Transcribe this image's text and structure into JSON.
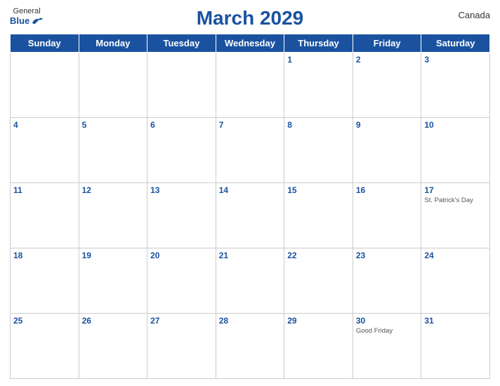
{
  "header": {
    "logo": {
      "general": "General",
      "blue": "Blue"
    },
    "title": "March 2029",
    "country": "Canada"
  },
  "weekdays": [
    "Sunday",
    "Monday",
    "Tuesday",
    "Wednesday",
    "Thursday",
    "Friday",
    "Saturday"
  ],
  "weeks": [
    [
      {
        "day": "",
        "event": ""
      },
      {
        "day": "",
        "event": ""
      },
      {
        "day": "",
        "event": ""
      },
      {
        "day": "",
        "event": ""
      },
      {
        "day": "1",
        "event": ""
      },
      {
        "day": "2",
        "event": ""
      },
      {
        "day": "3",
        "event": ""
      }
    ],
    [
      {
        "day": "4",
        "event": ""
      },
      {
        "day": "5",
        "event": ""
      },
      {
        "day": "6",
        "event": ""
      },
      {
        "day": "7",
        "event": ""
      },
      {
        "day": "8",
        "event": ""
      },
      {
        "day": "9",
        "event": ""
      },
      {
        "day": "10",
        "event": ""
      }
    ],
    [
      {
        "day": "11",
        "event": ""
      },
      {
        "day": "12",
        "event": ""
      },
      {
        "day": "13",
        "event": ""
      },
      {
        "day": "14",
        "event": ""
      },
      {
        "day": "15",
        "event": ""
      },
      {
        "day": "16",
        "event": ""
      },
      {
        "day": "17",
        "event": "St. Patrick's Day"
      }
    ],
    [
      {
        "day": "18",
        "event": ""
      },
      {
        "day": "19",
        "event": ""
      },
      {
        "day": "20",
        "event": ""
      },
      {
        "day": "21",
        "event": ""
      },
      {
        "day": "22",
        "event": ""
      },
      {
        "day": "23",
        "event": ""
      },
      {
        "day": "24",
        "event": ""
      }
    ],
    [
      {
        "day": "25",
        "event": ""
      },
      {
        "day": "26",
        "event": ""
      },
      {
        "day": "27",
        "event": ""
      },
      {
        "day": "28",
        "event": ""
      },
      {
        "day": "29",
        "event": ""
      },
      {
        "day": "30",
        "event": "Good Friday"
      },
      {
        "day": "31",
        "event": ""
      }
    ]
  ]
}
